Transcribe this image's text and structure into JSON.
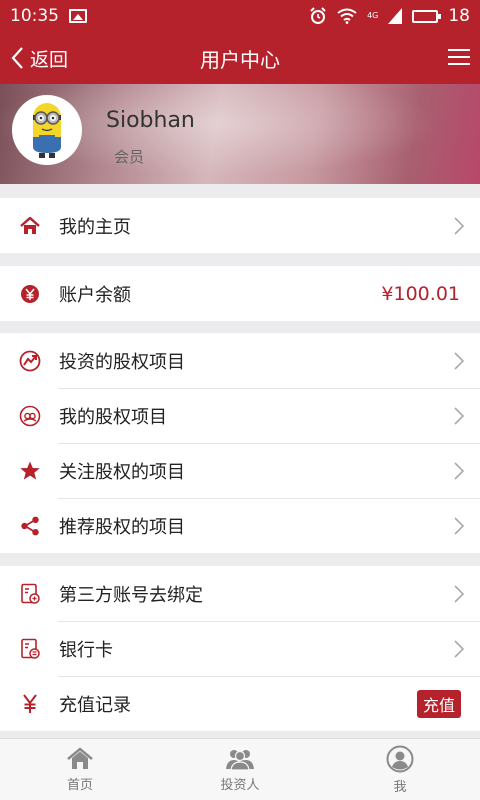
{
  "status_bar": {
    "time": "10:35",
    "network": "4G",
    "battery": "18"
  },
  "nav": {
    "back_label": "返回",
    "title": "用户中心"
  },
  "profile": {
    "name": "Siobhan",
    "role": "会员"
  },
  "sections": {
    "home": {
      "label": "我的主页"
    },
    "balance": {
      "label": "账户余额",
      "amount": "¥100.01"
    },
    "projects": [
      {
        "label": "投资的股权项目",
        "icon": "invest-icon"
      },
      {
        "label": "我的股权项目",
        "icon": "people-circle-icon"
      },
      {
        "label": "关注股权的项目",
        "icon": "star-icon"
      },
      {
        "label": "推荐股权的项目",
        "icon": "share-icon"
      }
    ],
    "account": [
      {
        "label": "第三方账号去绑定",
        "icon": "bind-icon"
      },
      {
        "label": "银行卡",
        "icon": "bank-card-icon"
      },
      {
        "label": "充值记录",
        "icon": "yen-icon",
        "badge": "充值"
      }
    ]
  },
  "tabs": [
    {
      "label": "首页",
      "icon": "home-icon"
    },
    {
      "label": "投资人",
      "icon": "investors-icon"
    },
    {
      "label": "我",
      "icon": "user-icon"
    }
  ],
  "colors": {
    "accent": "#b6222c",
    "background": "#ececef"
  }
}
